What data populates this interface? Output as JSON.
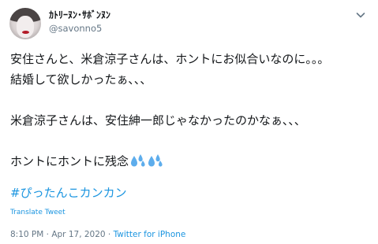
{
  "author": {
    "display_name": "ｶﾄﾘｰﾇﾝ･ｻﾎﾞﾝﾇﾝ",
    "handle": "@savonno5",
    "avatar_icon": "profile-photo"
  },
  "tweet": {
    "lines": [
      "安住さんと、米倉涼子さんは、ホントにお似合いなのに。。。",
      "結婚して欲しかったぁ、、、",
      "",
      "米倉涼子さんは、安住紳一郎じゃなかったのかなぁ、、、",
      "",
      "ホントにホントに残念"
    ],
    "emoji": "sweat-droplets-icon",
    "hashtag": "#ぴったんこカンカン",
    "translate_label": "Translate Tweet"
  },
  "meta": {
    "time": "8:10 PM",
    "separator1": " · ",
    "date": "Apr 17, 2020",
    "separator2": " · ",
    "source": "Twitter for iPhone"
  },
  "colors": {
    "link": "#1b95e0",
    "secondary": "#657786",
    "text": "#14171a"
  }
}
